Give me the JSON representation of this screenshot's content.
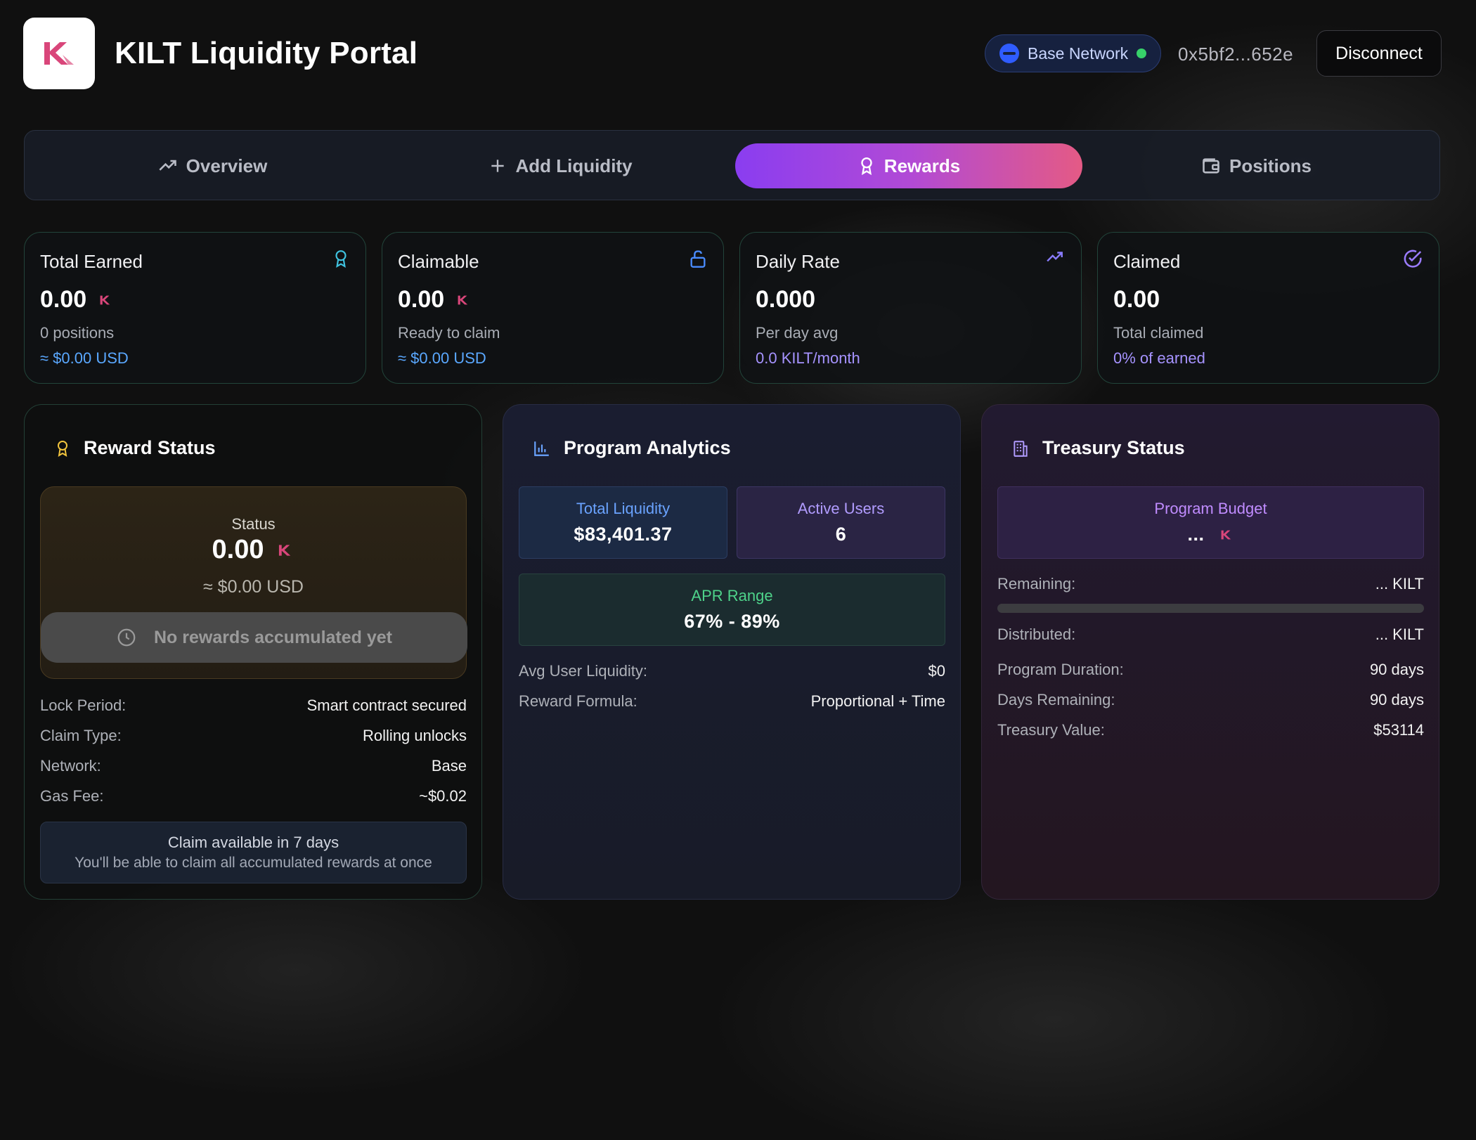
{
  "header": {
    "title": "KILT Liquidity Portal",
    "logo_icon": "kilt-logo-icon",
    "network_label": "Base Network",
    "network_status_color": "#37d16a",
    "wallet_address": "0x5bf2...652e",
    "disconnect_label": "Disconnect"
  },
  "tabs": [
    {
      "label": "Overview",
      "icon": "trending-up-icon",
      "active": false
    },
    {
      "label": "Add Liquidity",
      "icon": "plus-icon",
      "active": false
    },
    {
      "label": "Rewards",
      "icon": "award-icon",
      "active": true
    },
    {
      "label": "Positions",
      "icon": "wallet-icon",
      "active": false
    }
  ],
  "stats": [
    {
      "title": "Total Earned",
      "value": "0.00",
      "sub": "0 positions",
      "usd": "≈ $0.00 USD",
      "icon": "award-icon",
      "icon_color": "#3fc3e0"
    },
    {
      "title": "Claimable",
      "value": "0.00",
      "sub": "Ready to claim",
      "usd": "≈ $0.00 USD",
      "icon": "unlock-icon",
      "icon_color": "#4a8cff"
    },
    {
      "title": "Daily Rate",
      "value": "0.000",
      "sub": "Per day avg",
      "usd": "0.0 KILT/month",
      "icon": "trending-up-icon",
      "icon_color": "#8a7cff"
    },
    {
      "title": "Claimed",
      "value": "0.00",
      "sub": "Total claimed",
      "usd": "0% of earned",
      "icon": "check-circle-icon",
      "icon_color": "#9b7cff"
    }
  ],
  "reward_status": {
    "title": "Reward Status",
    "status_label": "Status",
    "status_value": "0.00",
    "status_usd": "≈ $0.00 USD",
    "claim_button": "No rewards accumulated yet",
    "details": [
      {
        "k": "Lock Period:",
        "v": "Smart contract secured"
      },
      {
        "k": "Claim Type:",
        "v": "Rolling unlocks"
      },
      {
        "k": "Network:",
        "v": "Base"
      },
      {
        "k": "Gas Fee:",
        "v": "~$0.02"
      }
    ],
    "note_title": "Claim available in 7 days",
    "note_sub": "You'll be able to claim all accumulated rewards at once"
  },
  "analytics": {
    "title": "Program Analytics",
    "total_liquidity_label": "Total Liquidity",
    "total_liquidity": "$83,401.37",
    "active_users_label": "Active Users",
    "active_users": "6",
    "apr_label": "APR Range",
    "apr_value": "67% - 89%",
    "details": [
      {
        "k": "Avg User Liquidity:",
        "v": "$0"
      },
      {
        "k": "Reward Formula:",
        "v": "Proportional + Time"
      }
    ]
  },
  "treasury": {
    "title": "Treasury Status",
    "budget_label": "Program Budget",
    "budget_value": "...",
    "remaining_label": "Remaining:",
    "remaining_value": "... KILT",
    "remaining_fraction": 0,
    "distributed_label": "Distributed:",
    "distributed_value": "... KILT",
    "details": [
      {
        "k": "Program Duration:",
        "v": "90 days"
      },
      {
        "k": "Days Remaining:",
        "v": "90 days"
      },
      {
        "k": "Treasury Value:",
        "v": "$53114"
      }
    ]
  },
  "colors": {
    "accent_gradient_start": "#8a3df0",
    "accent_gradient_end": "#e45a85",
    "kilt_pink": "#d9467a"
  }
}
